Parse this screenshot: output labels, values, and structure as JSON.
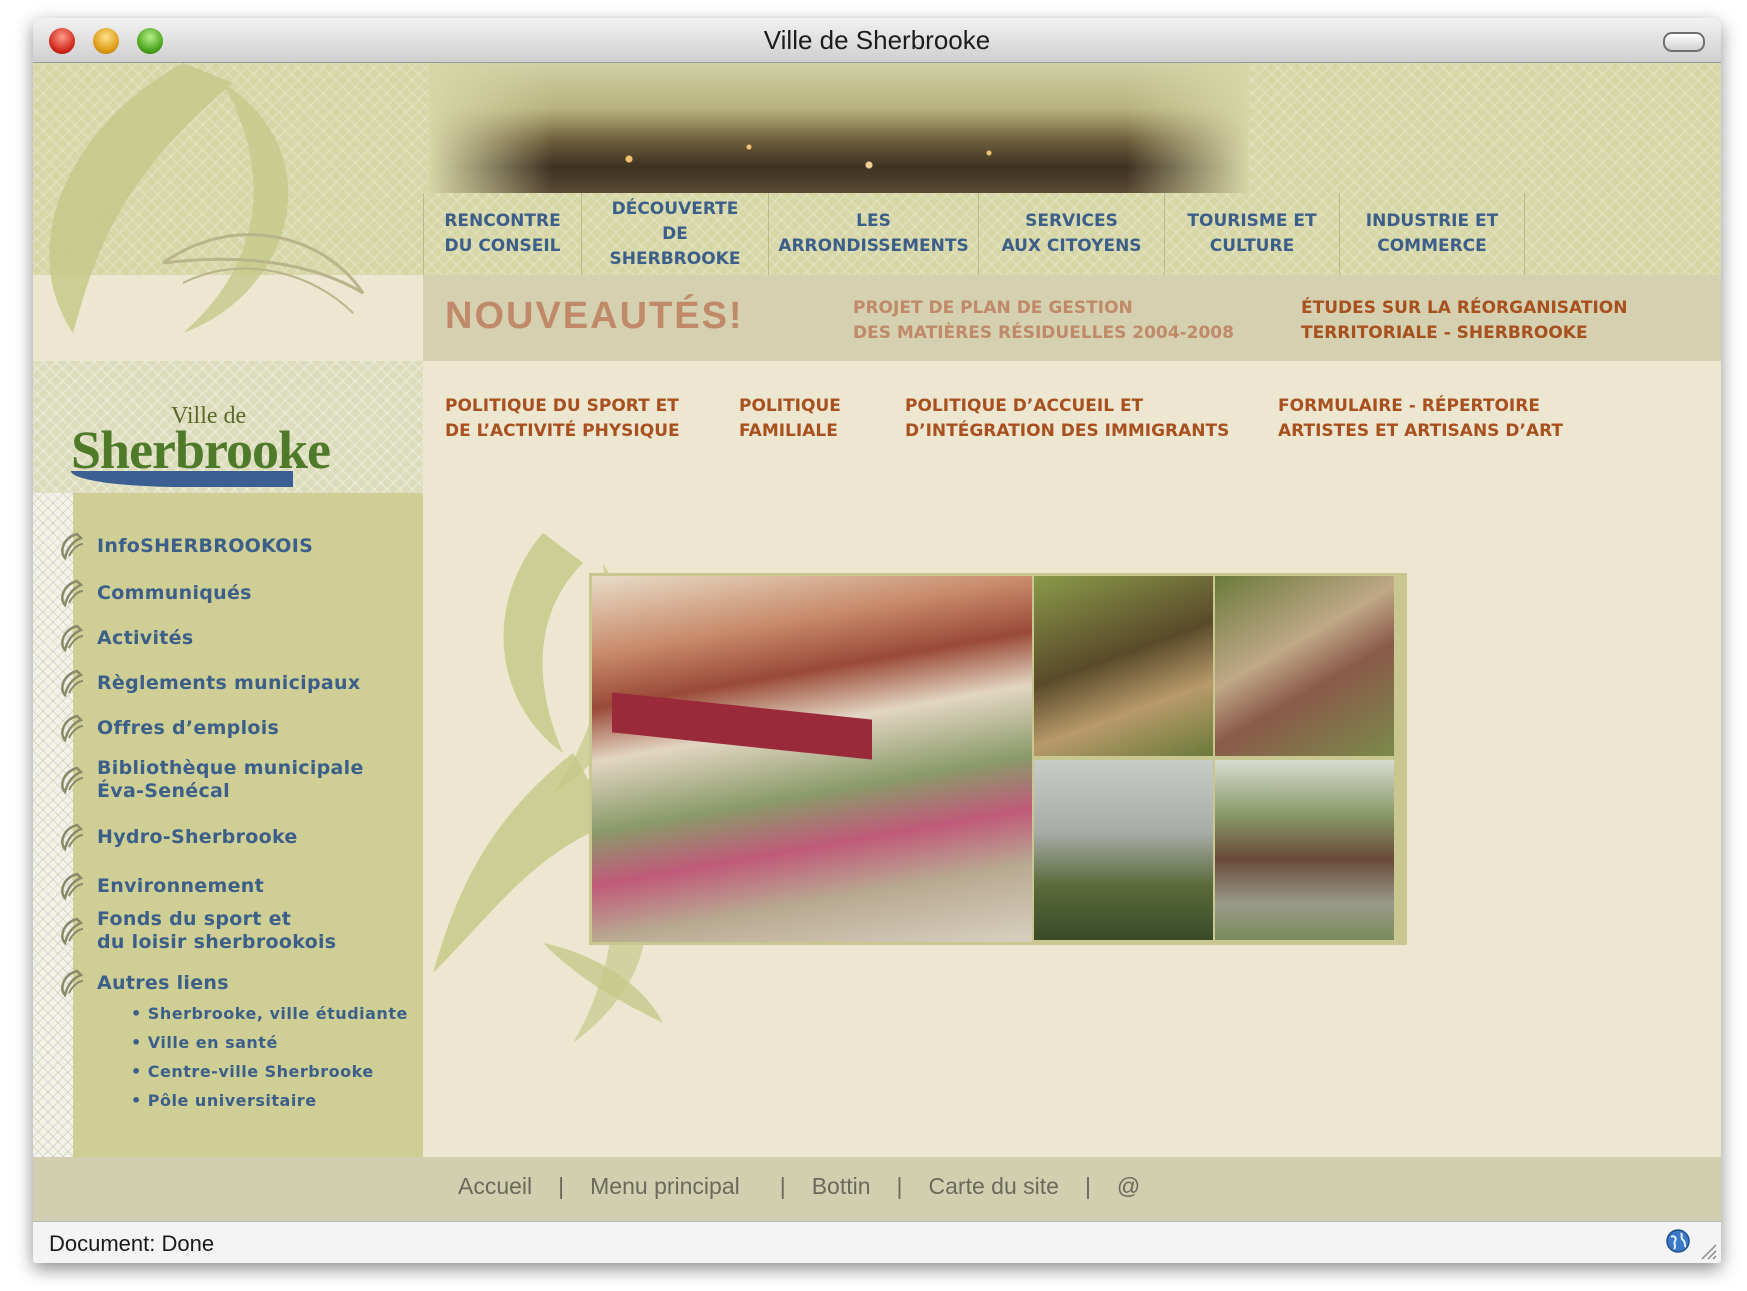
{
  "window": {
    "title": "Ville de Sherbrooke"
  },
  "nav": [
    {
      "label": "RENCONTRE\nDU CONSEIL"
    },
    {
      "label": "DÉCOUVERTE\nDE SHERBROOKE"
    },
    {
      "label": "LES\nARRONDISSEMENTS"
    },
    {
      "label": "SERVICES\nAUX CITOYENS"
    },
    {
      "label": "TOURISME ET\nCULTURE"
    },
    {
      "label": "INDUSTRIE ET\nCOMMERCE"
    }
  ],
  "news": {
    "title": "NOUVEAUTÉS!",
    "link_a": "PROJET DE PLAN DE GESTION\nDES MATIÈRES RÉSIDUELLES 2004-2008",
    "link_b": "ÉTUDES SUR LA RÉORGANISATION\nTERRITORIALE - SHERBROOKE"
  },
  "sub_links": [
    {
      "label": "POLITIQUE DU SPORT ET\nDE L’ACTIVITÉ PHYSIQUE"
    },
    {
      "label": "POLITIQUE\nFAMILIALE"
    },
    {
      "label": "POLITIQUE D’ACCUEIL ET\nD’INTÉGRATION DES IMMIGRANTS"
    },
    {
      "label": "FORMULAIRE - RÉPERTOIRE\nARTISTES ET ARTISANS D’ART"
    }
  ],
  "logo": {
    "small": "Ville de",
    "name": "Sherbrooke"
  },
  "sidebar": {
    "items": [
      {
        "label": "InfoSHERBROOKOIS"
      },
      {
        "label": "Communiqués"
      },
      {
        "label": "Activités"
      },
      {
        "label": "Règlements municipaux"
      },
      {
        "label": "Offres d’emplois"
      },
      {
        "label": "Bibliothèque municipale\nÉva-Senécal"
      },
      {
        "label": "Hydro-Sherbrooke"
      },
      {
        "label": "Environnement"
      },
      {
        "label": "Fonds du sport et\ndu loisir sherbrookois"
      },
      {
        "label": "Autres liens"
      }
    ],
    "sub_items": [
      {
        "label": "• Sherbrooke, ville étudiante"
      },
      {
        "label": "• Ville en santé"
      },
      {
        "label": "• Centre-ville Sherbrooke"
      },
      {
        "label": "• Pôle universitaire"
      }
    ]
  },
  "footer": {
    "links": [
      "Accueil",
      "Menu principal",
      "Bottin",
      "Carte du site",
      "@"
    ],
    "separator": "|"
  },
  "status": {
    "text": "Document: Done"
  },
  "colors": {
    "nav_text": "#3c5f8a",
    "news_accent": "#a8501e",
    "sidebar_bg": "#cfcf95",
    "content_bg": "#ede7d2"
  }
}
